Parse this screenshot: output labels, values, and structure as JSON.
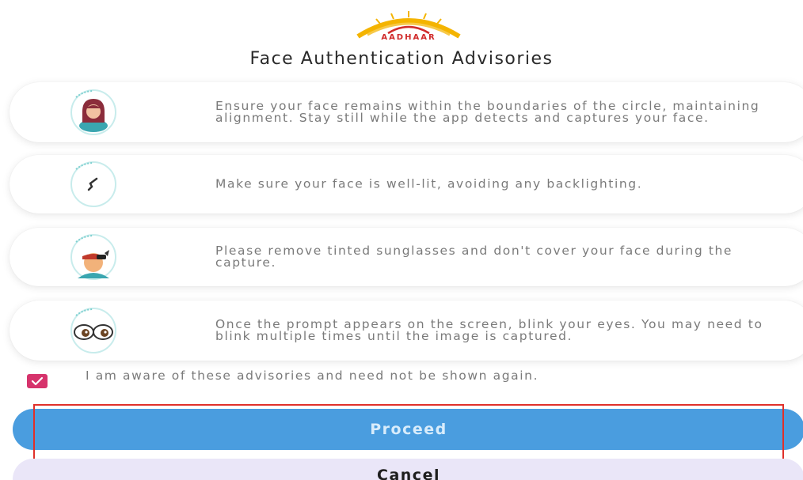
{
  "header": {
    "logo_text": "AADHAAR",
    "title": "Face Authentication Advisories"
  },
  "advisories": [
    {
      "icon": "face-in-circle-icon",
      "text": "Ensure your face remains within the boundaries of the circle, maintaining alignment. Stay still while the app detects and captures your face."
    },
    {
      "icon": "lighting-icon",
      "text": "Make sure your face is well-lit, avoiding any backlighting."
    },
    {
      "icon": "sunglasses-face-icon",
      "text": "Please remove tinted sunglasses and don't cover your face during the capture."
    },
    {
      "icon": "blinking-eyes-icon",
      "text": "Once the prompt appears on the screen, blink your eyes. You may need to blink multiple times until the image is captured."
    }
  ],
  "acknowledge": {
    "checked": true,
    "label": "I am aware of these advisories and need not be shown again."
  },
  "actions": {
    "proceed_label": "Proceed",
    "cancel_label": "Cancel"
  },
  "colors": {
    "primary_button": "#4a9ddf",
    "checkbox": "#d6336c",
    "highlight": "#e0302a",
    "secondary_button": "#eae6f8"
  }
}
